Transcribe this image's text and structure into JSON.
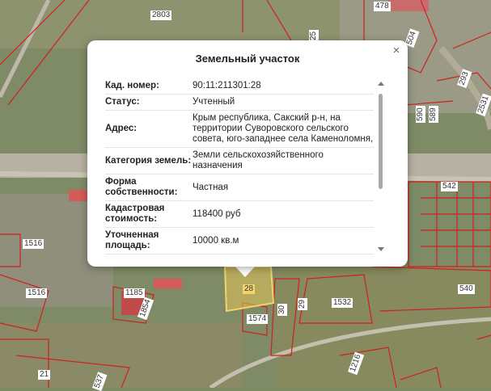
{
  "map": {
    "parcel_labels": {
      "p2803": "2803",
      "p25": "25",
      "p478": "478",
      "p504": "504",
      "p293": "293",
      "p590": "590",
      "p589": "589",
      "p2531": "2531",
      "p542": "542",
      "p1516a": "1516",
      "p1516b": "1516",
      "p1185": "1185",
      "p1854": "1854",
      "p28": "28",
      "p30": "30",
      "p29": "29",
      "p1532": "1532",
      "p1574": "1574",
      "p540": "540",
      "p1216": "1216",
      "p21": "21",
      "p537": "537"
    }
  },
  "popup": {
    "title": "Земельный участок",
    "close_glyph": "×",
    "rows": [
      {
        "key": "Кад. номер:",
        "value": "90:11:211301:28"
      },
      {
        "key": "Статус:",
        "value": "Учтенный"
      },
      {
        "key": "Адрес:",
        "value": "Крым республика, Сакский р-н, на территории Суворовского сельского совета, юго-западнее села Каменоломня,"
      },
      {
        "key": "Категория земель:",
        "value": "Земли сельскохозяйственного назначения"
      },
      {
        "key": "Форма собственности:",
        "value": "Частная"
      },
      {
        "key": "Кадастровая стоимость:",
        "value": "118400 руб"
      },
      {
        "key": "Уточненная площадь:",
        "value": "10000 кв.м"
      }
    ]
  }
}
